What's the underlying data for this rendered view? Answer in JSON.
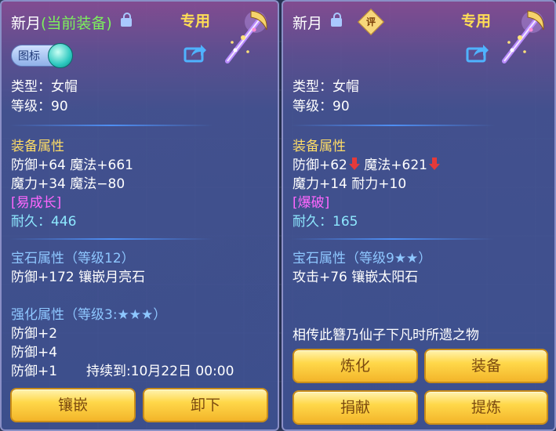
{
  "left": {
    "name": "新月",
    "equipped_tag": "(当前装备)",
    "exclusive": "专用",
    "icon_toggle_label": "图标",
    "type_line": "类型：女帽",
    "level_line": "等级：90",
    "attr_title": "装备属性",
    "attr_lines": [
      "防御+64 魔法+661",
      "魔力+34 魔法−80"
    ],
    "special_tag": "[易成长]",
    "durability": "耐久：446",
    "gem_title": "宝石属性（等级12）",
    "gem_line": "防御+172 镶嵌月亮石",
    "strength_title": "强化属性（等级3:★★★）",
    "strength_lines": [
      "防御+2",
      "防御+4"
    ],
    "strength_last": "防御+1",
    "expire": "持续到:10月22日 00:00",
    "buttons": [
      "镶嵌",
      "卸下"
    ]
  },
  "right": {
    "name": "新月",
    "ping": "评",
    "exclusive": "专用",
    "type_line": "类型：女帽",
    "level_line": "等级：90",
    "attr_title": "装备属性",
    "attr_a": "防御+62",
    "attr_b": "魔法+621",
    "attr_line2": "魔力+14 耐力+10",
    "special_tag": "[爆破]",
    "durability": "耐久：165",
    "gem_title": "宝石属性（等级9★★）",
    "gem_line": "攻击+76 镶嵌太阳石",
    "desc": "相传此簪乃仙子下凡时所遗之物",
    "buttons": [
      "炼化",
      "装备",
      "捐献",
      "提炼"
    ]
  },
  "colors": {
    "gold_title": "#ffdd66",
    "blue_title": "#8ec7ff",
    "magenta_tag": "#ff67ff",
    "cyan_value": "#8ee9ff",
    "equipped_green": "#7df15c"
  },
  "icons": [
    "lock-icon",
    "share-icon",
    "hairpin-weapon-icon",
    "down-arrow-icon"
  ]
}
